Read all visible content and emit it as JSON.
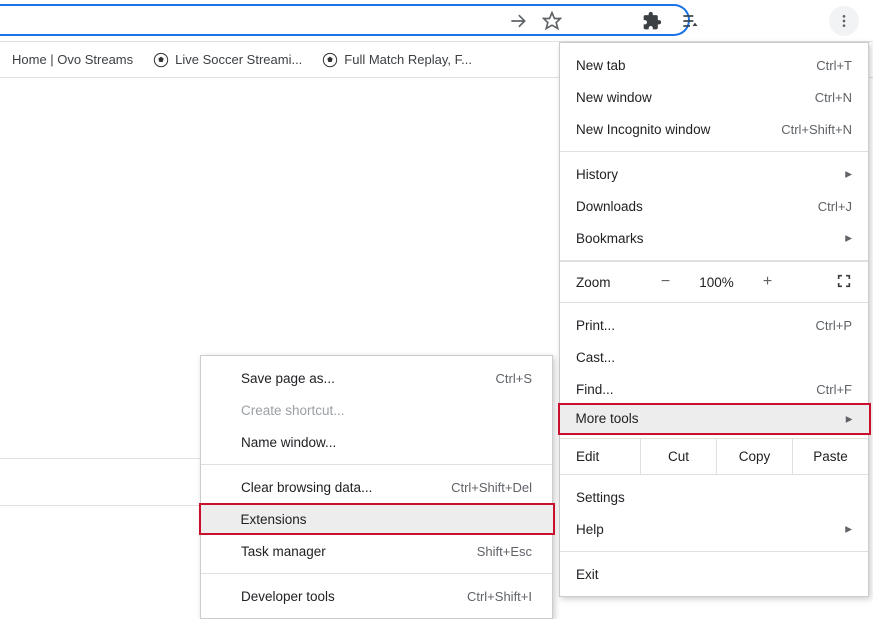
{
  "bookmarks": {
    "items": [
      {
        "label": "Home | Ovo Streams",
        "has_icon": false
      },
      {
        "label": "Live Soccer Streami...",
        "has_icon": true
      },
      {
        "label": "Full Match Replay, F...",
        "has_icon": true
      }
    ]
  },
  "main_menu": {
    "new_tab": {
      "label": "New tab",
      "shortcut": "Ctrl+T"
    },
    "new_window": {
      "label": "New window",
      "shortcut": "Ctrl+N"
    },
    "new_incognito": {
      "label": "New Incognito window",
      "shortcut": "Ctrl+Shift+N"
    },
    "history": {
      "label": "History"
    },
    "downloads": {
      "label": "Downloads",
      "shortcut": "Ctrl+J"
    },
    "bookmarks": {
      "label": "Bookmarks"
    },
    "zoom": {
      "label": "Zoom",
      "percent": "100%"
    },
    "print": {
      "label": "Print...",
      "shortcut": "Ctrl+P"
    },
    "cast": {
      "label": "Cast..."
    },
    "find": {
      "label": "Find...",
      "shortcut": "Ctrl+F"
    },
    "more_tools": {
      "label": "More tools"
    },
    "edit": {
      "label": "Edit",
      "cut": "Cut",
      "copy": "Copy",
      "paste": "Paste"
    },
    "settings": {
      "label": "Settings"
    },
    "help": {
      "label": "Help"
    },
    "exit": {
      "label": "Exit"
    }
  },
  "submenu": {
    "save_page": {
      "label": "Save page as...",
      "shortcut": "Ctrl+S"
    },
    "create_shortcut": {
      "label": "Create shortcut..."
    },
    "name_window": {
      "label": "Name window..."
    },
    "clear_data": {
      "label": "Clear browsing data...",
      "shortcut": "Ctrl+Shift+Del"
    },
    "extensions": {
      "label": "Extensions"
    },
    "task_manager": {
      "label": "Task manager",
      "shortcut": "Shift+Esc"
    },
    "dev_tools": {
      "label": "Developer tools",
      "shortcut": "Ctrl+Shift+I"
    }
  },
  "colors": {
    "highlight": "#c8102e"
  }
}
